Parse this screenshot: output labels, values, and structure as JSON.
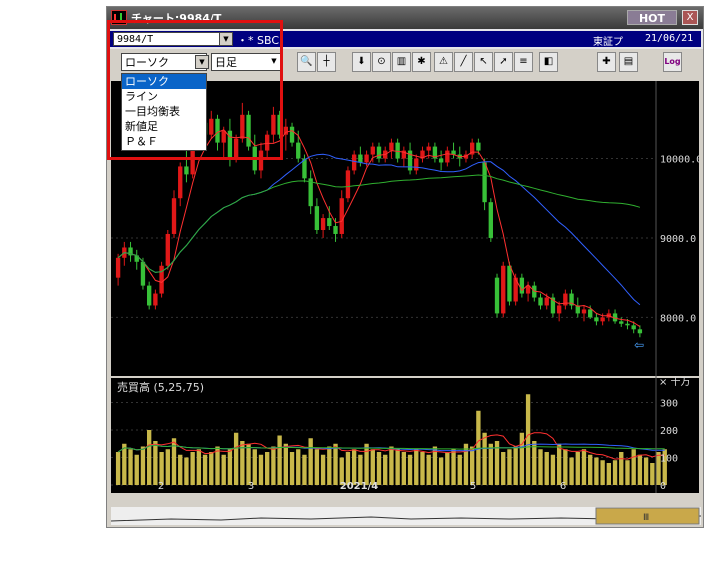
{
  "window": {
    "title": "チャート:9984/T",
    "hot_label": "HOT",
    "close_glyph": "X"
  },
  "symbol": {
    "value": "9984/T"
  },
  "broker": "・* SBC",
  "exchange": "東証プ",
  "date": "21/06/21",
  "chart_type": {
    "selected": "ローソク",
    "options": [
      "ローソク",
      "ライン",
      "一目均衡表",
      "新値足",
      "Ｐ＆Ｆ"
    ]
  },
  "period": {
    "selected": "日足"
  },
  "toolbar": {
    "log_label": "Log"
  },
  "volume_label": "売買高 (5,25,75)",
  "volume_unit": "× 十万",
  "chart_data": [
    {
      "type": "candlestick",
      "ylim": [
        7300,
        10900
      ],
      "yticks": [
        8000,
        9000,
        10000
      ],
      "ytick_labels": [
        "8000.0",
        "9000.0",
        "10000.0"
      ],
      "xtick_labels": [
        "2",
        "3",
        "2021/4",
        "5",
        "6"
      ],
      "xtick_positions": [
        10,
        30,
        55,
        80,
        100
      ],
      "candles": [
        [
          8500,
          8800,
          8400,
          8750
        ],
        [
          8750,
          8950,
          8650,
          8880
        ],
        [
          8880,
          8950,
          8700,
          8780
        ],
        [
          8780,
          8850,
          8600,
          8700
        ],
        [
          8700,
          8750,
          8350,
          8400
        ],
        [
          8400,
          8450,
          8100,
          8150
        ],
        [
          8150,
          8350,
          8100,
          8300
        ],
        [
          8300,
          8700,
          8250,
          8650
        ],
        [
          8650,
          9100,
          8600,
          9050
        ],
        [
          9050,
          9600,
          9000,
          9500
        ],
        [
          9500,
          9950,
          9400,
          9900
        ],
        [
          9900,
          10100,
          9700,
          9800
        ],
        [
          9800,
          10300,
          9750,
          10200
        ],
        [
          10200,
          10600,
          10100,
          10450
        ],
        [
          10450,
          10550,
          10200,
          10300
        ],
        [
          10300,
          10600,
          10250,
          10500
        ],
        [
          10500,
          10550,
          10100,
          10200
        ],
        [
          10200,
          10400,
          10000,
          10350
        ],
        [
          10350,
          10500,
          9900,
          10000
        ],
        [
          10000,
          10300,
          9950,
          10250
        ],
        [
          10250,
          10700,
          10200,
          10550
        ],
        [
          10550,
          10600,
          10100,
          10150
        ],
        [
          10150,
          10300,
          9800,
          9850
        ],
        [
          9850,
          10200,
          9750,
          10100
        ],
        [
          10100,
          10350,
          10000,
          10300
        ],
        [
          10300,
          10650,
          10200,
          10550
        ],
        [
          10550,
          10600,
          10250,
          10300
        ],
        [
          10300,
          10500,
          10100,
          10400
        ],
        [
          10400,
          10450,
          10150,
          10200
        ],
        [
          10200,
          10350,
          9950,
          10000
        ],
        [
          10000,
          10050,
          9700,
          9750
        ],
        [
          9750,
          9850,
          9300,
          9400
        ],
        [
          9400,
          9500,
          9050,
          9100
        ],
        [
          9100,
          9300,
          9000,
          9250
        ],
        [
          9250,
          9400,
          9100,
          9150
        ],
        [
          9150,
          9250,
          8950,
          9050
        ],
        [
          9050,
          9600,
          9000,
          9500
        ],
        [
          9500,
          9900,
          9450,
          9850
        ],
        [
          9850,
          10100,
          9800,
          10050
        ],
        [
          10050,
          10150,
          9900,
          9950
        ],
        [
          9950,
          10100,
          9900,
          10050
        ],
        [
          10050,
          10200,
          9950,
          10150
        ],
        [
          10150,
          10200,
          9950,
          10000
        ],
        [
          10000,
          10150,
          9950,
          10100
        ],
        [
          10100,
          10250,
          10000,
          10200
        ],
        [
          10200,
          10250,
          9950,
          10000
        ],
        [
          10000,
          10150,
          9900,
          10100
        ],
        [
          10100,
          10200,
          9800,
          9850
        ],
        [
          9850,
          10050,
          9800,
          10000
        ],
        [
          10000,
          10150,
          9950,
          10100
        ],
        [
          10100,
          10200,
          10000,
          10150
        ],
        [
          10150,
          10200,
          9950,
          10000
        ],
        [
          10000,
          10100,
          9850,
          9950
        ],
        [
          9950,
          10150,
          9900,
          10100
        ],
        [
          10100,
          10200,
          10000,
          10050
        ],
        [
          10050,
          10150,
          9900,
          10000
        ],
        [
          10000,
          10100,
          9950,
          10050
        ],
        [
          10050,
          10250,
          10000,
          10200
        ],
        [
          10200,
          10250,
          10050,
          10100
        ],
        [
          9950,
          10000,
          9350,
          9450
        ],
        [
          9450,
          9500,
          8950,
          9000
        ],
        [
          8500,
          8550,
          8000,
          8050
        ],
        [
          8050,
          8700,
          8000,
          8650
        ],
        [
          8650,
          8700,
          8150,
          8200
        ],
        [
          8200,
          8550,
          8150,
          8500
        ],
        [
          8500,
          8550,
          8250,
          8300
        ],
        [
          8300,
          8450,
          8200,
          8400
        ],
        [
          8400,
          8450,
          8200,
          8250
        ],
        [
          8250,
          8300,
          8100,
          8150
        ],
        [
          8150,
          8300,
          8100,
          8250
        ],
        [
          8250,
          8300,
          8000,
          8050
        ],
        [
          8050,
          8200,
          7950,
          8150
        ],
        [
          8150,
          8350,
          8100,
          8300
        ],
        [
          8300,
          8350,
          8100,
          8150
        ],
        [
          8150,
          8250,
          8000,
          8050
        ],
        [
          8050,
          8150,
          7950,
          8100
        ],
        [
          8100,
          8150,
          7980,
          8000
        ],
        [
          8000,
          8050,
          7900,
          7950
        ],
        [
          7950,
          8050,
          7900,
          8000
        ],
        [
          8000,
          8100,
          7950,
          8050
        ],
        [
          8050,
          8100,
          7920,
          7950
        ],
        [
          7950,
          8000,
          7880,
          7920
        ],
        [
          7920,
          7980,
          7850,
          7900
        ],
        [
          7900,
          7950,
          7800,
          7850
        ],
        [
          7850,
          7900,
          7750,
          7800
        ]
      ]
    },
    {
      "type": "bar",
      "ylim": [
        0,
        320
      ],
      "yticks": [
        0,
        100,
        200,
        300
      ],
      "ytick_labels": [
        "0",
        "100",
        "200",
        "300"
      ],
      "values": [
        120,
        150,
        130,
        110,
        140,
        200,
        160,
        120,
        130,
        170,
        110,
        100,
        120,
        130,
        110,
        120,
        140,
        110,
        130,
        190,
        160,
        150,
        130,
        110,
        120,
        140,
        180,
        150,
        120,
        130,
        110,
        170,
        130,
        110,
        140,
        150,
        100,
        120,
        130,
        110,
        150,
        130,
        120,
        110,
        140,
        130,
        120,
        110,
        130,
        120,
        110,
        140,
        100,
        120,
        130,
        110,
        150,
        140,
        270,
        190,
        150,
        160,
        120,
        130,
        140,
        190,
        330,
        160,
        130,
        120,
        110,
        150,
        130,
        100,
        120,
        130,
        110,
        100,
        90,
        80,
        90,
        120,
        90,
        130,
        110,
        100,
        80,
        120,
        130
      ]
    }
  ]
}
